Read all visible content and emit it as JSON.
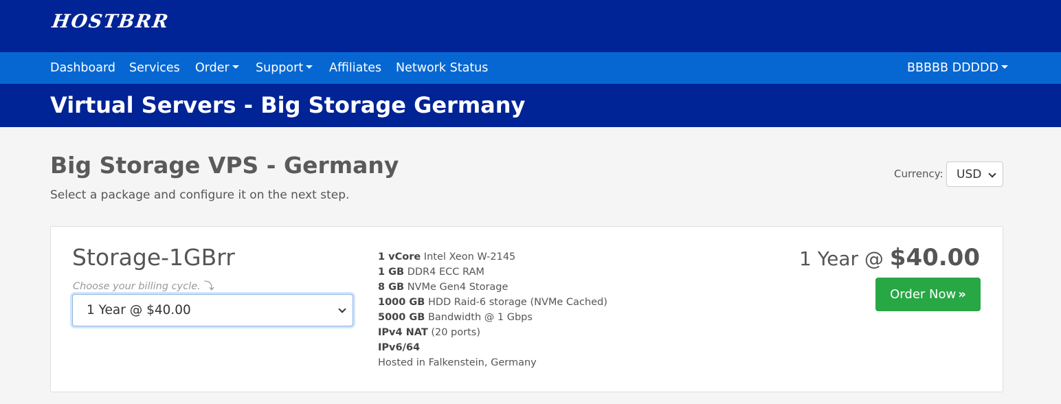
{
  "brand": {
    "logo_text": "HOSTBRR"
  },
  "nav": {
    "items": [
      {
        "label": "Dashboard",
        "dropdown": false
      },
      {
        "label": "Services",
        "dropdown": false
      },
      {
        "label": "Order",
        "dropdown": true
      },
      {
        "label": "Support",
        "dropdown": true
      },
      {
        "label": "Affiliates",
        "dropdown": false
      },
      {
        "label": "Network Status",
        "dropdown": false
      }
    ],
    "user_menu": "BBBBB DDDDD"
  },
  "page_header": {
    "title": "Virtual Servers - Big Storage Germany"
  },
  "product_group": {
    "title": "Big Storage VPS - Germany",
    "subtitle": "Select a package and configure it on the next step."
  },
  "currency": {
    "label": "Currency:",
    "selected": "USD"
  },
  "package": {
    "name": "Storage-1GBrr",
    "billing_hint": "Choose your billing cycle.",
    "billing_selected": "1 Year @ $40.00",
    "features": [
      {
        "bold": "1 vCore",
        "text": " Intel Xeon W-2145"
      },
      {
        "bold": "1 GB",
        "text": " DDR4 ECC RAM"
      },
      {
        "bold": "8 GB",
        "text": " NVMe Gen4 Storage"
      },
      {
        "bold": "1000 GB",
        "text": " HDD Raid-6 storage (NVMe Cached)"
      },
      {
        "bold": "5000 GB",
        "text": " Bandwidth @ 1 Gbps"
      },
      {
        "bold": "IPv4 NAT",
        "text": " (20 ports)"
      },
      {
        "bold": "IPv6/64",
        "text": ""
      },
      {
        "bold": "",
        "text": "Hosted in Falkenstein, Germany"
      }
    ],
    "price_prefix": "1 Year @ ",
    "price_amount": "$40.00",
    "order_button": "Order Now",
    "accent_color": "#28a745"
  },
  "colors": {
    "primary_dark": "#002395",
    "nav_blue": "#0767d2"
  }
}
